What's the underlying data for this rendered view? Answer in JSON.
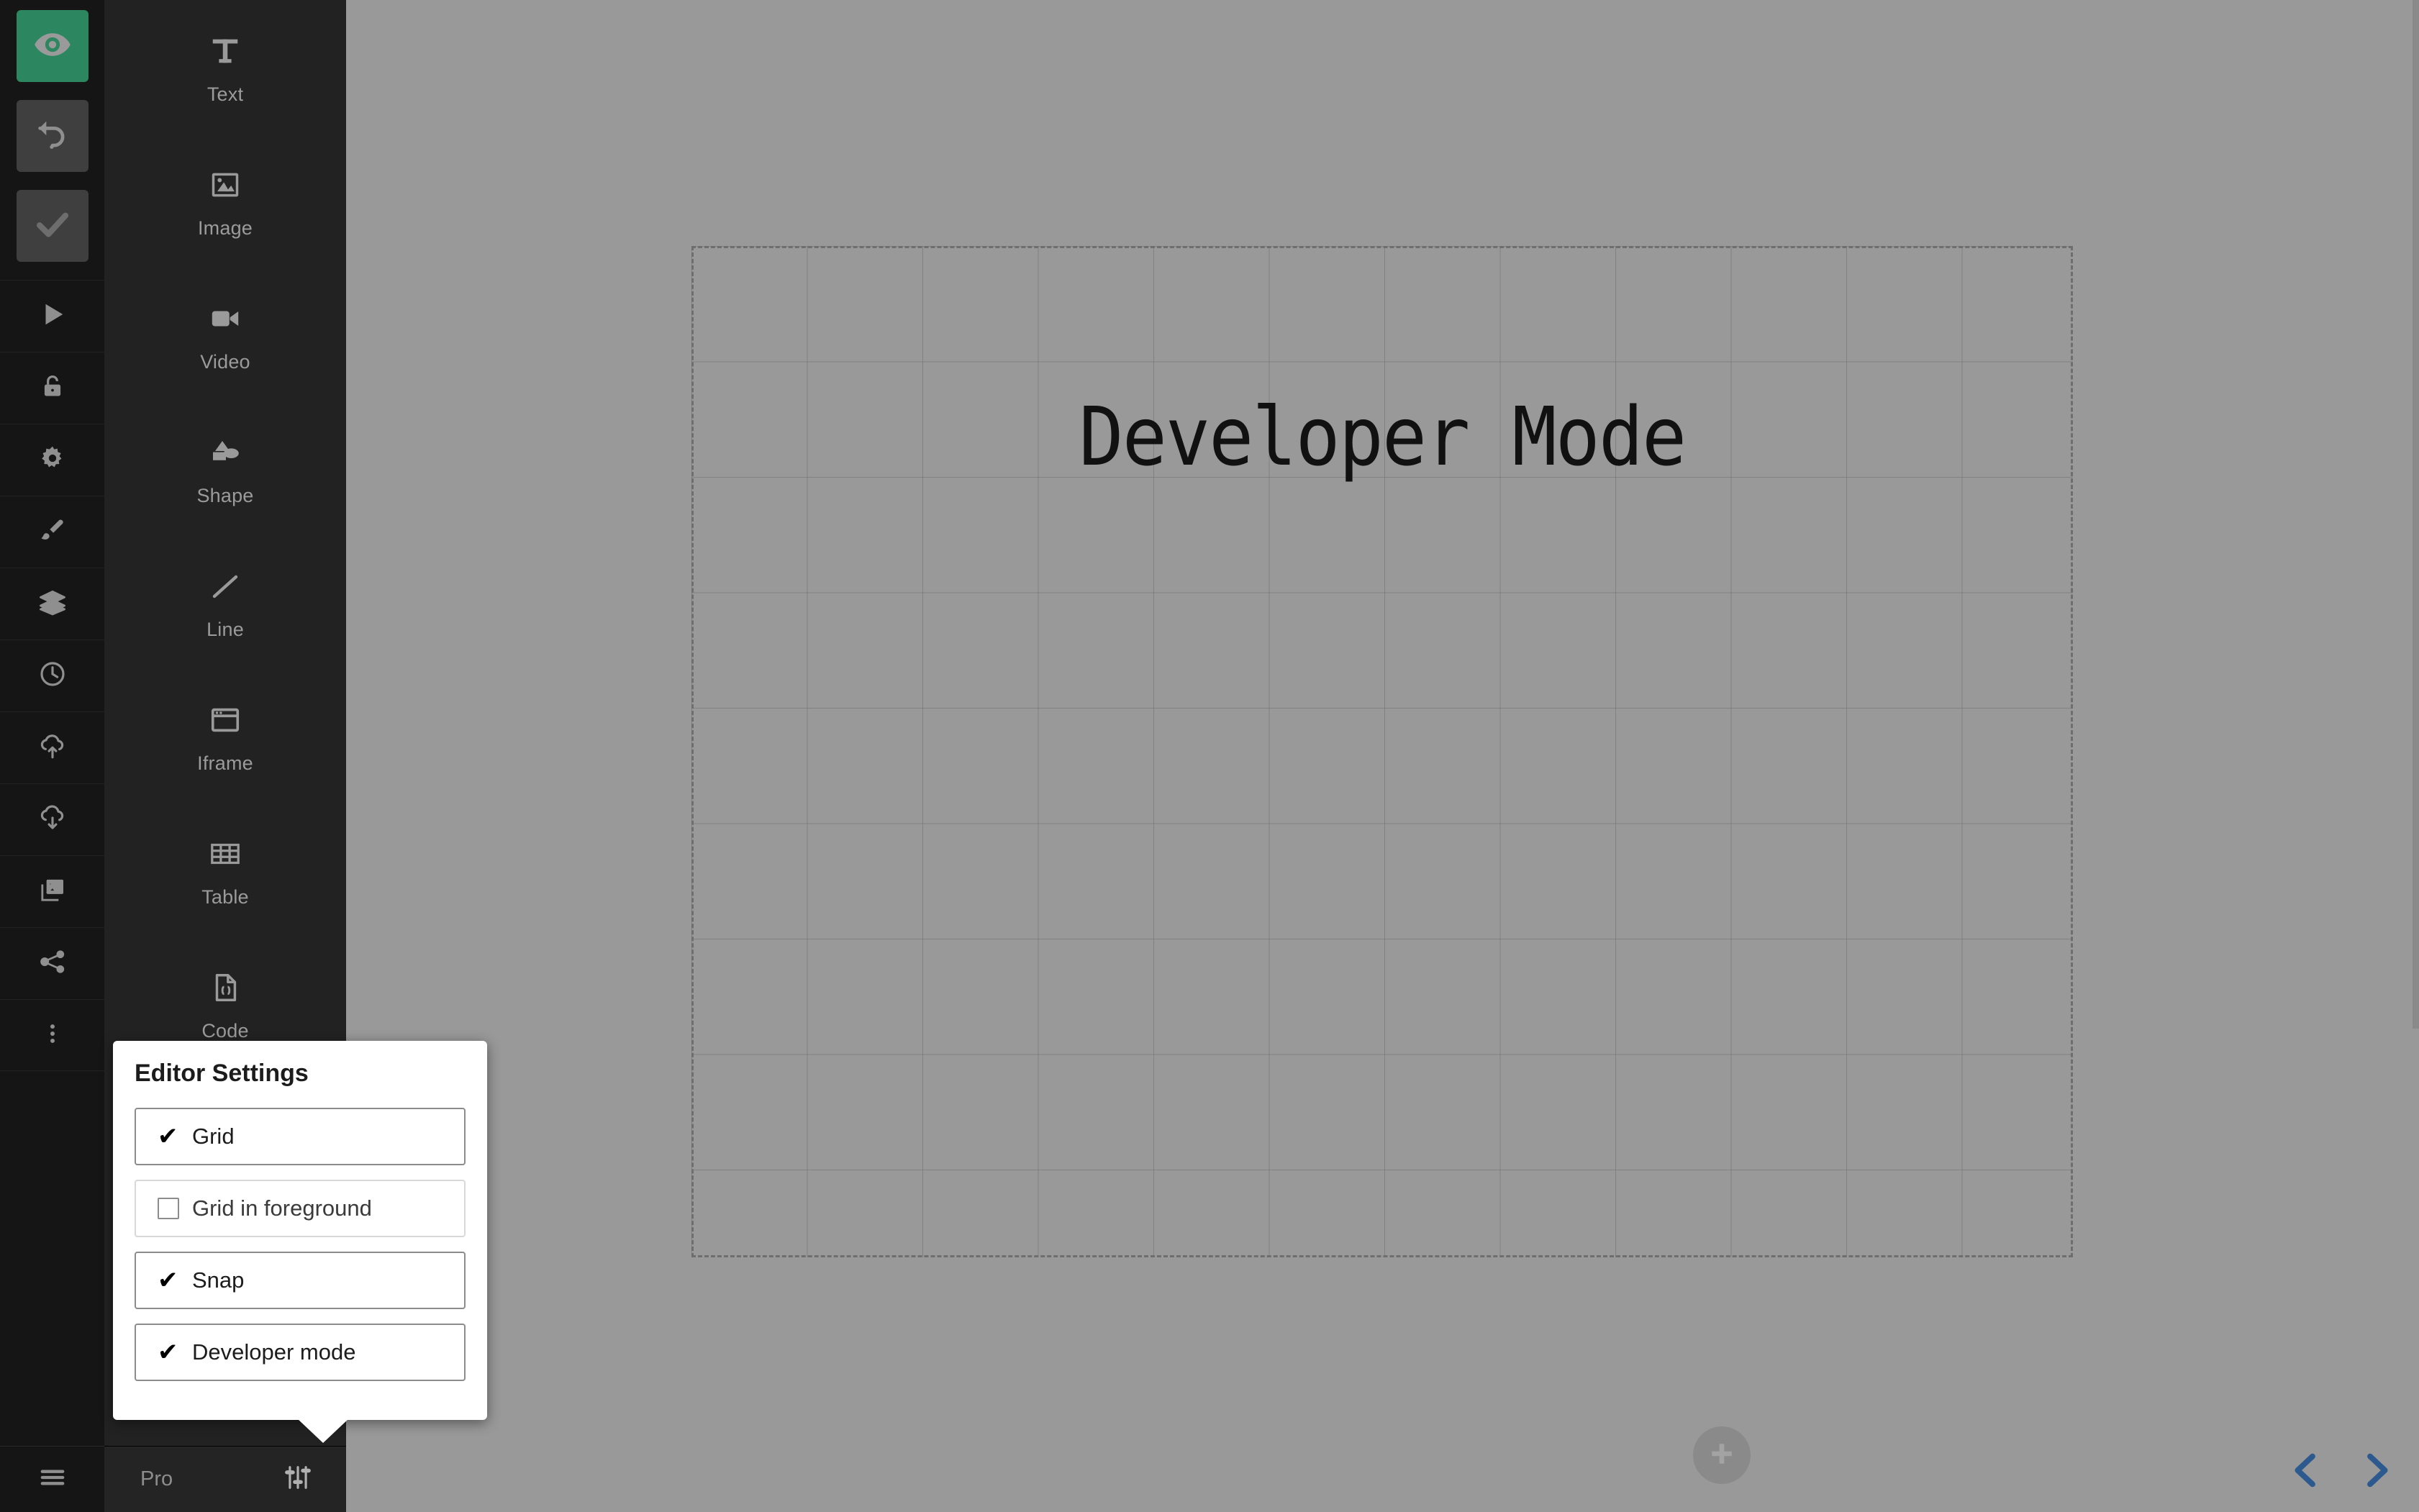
{
  "app": {
    "accent_green": "#2c8761",
    "canvas_bg": "#999999",
    "panel_bg": "#222222",
    "rail_bg": "#151515",
    "nav_arrow_color": "#2c5a8f"
  },
  "left_rail": {
    "top_buttons": [
      {
        "name": "preview-button",
        "icon": "eye-icon",
        "state": "active"
      },
      {
        "name": "undo-button",
        "icon": "undo-icon",
        "state": "normal"
      },
      {
        "name": "publish-button",
        "icon": "checkmark-icon",
        "state": "normal"
      }
    ],
    "items": [
      {
        "name": "sidebar-item-play",
        "icon": "play-icon"
      },
      {
        "name": "sidebar-item-lock",
        "icon": "lock-icon"
      },
      {
        "name": "sidebar-item-settings",
        "icon": "gear-icon"
      },
      {
        "name": "sidebar-item-design",
        "icon": "brush-icon"
      },
      {
        "name": "sidebar-item-layers",
        "icon": "layers-icon"
      },
      {
        "name": "sidebar-item-history",
        "icon": "clock-icon"
      },
      {
        "name": "sidebar-item-upload",
        "icon": "cloud-upload-icon"
      },
      {
        "name": "sidebar-item-download",
        "icon": "cloud-download-icon"
      },
      {
        "name": "sidebar-item-media",
        "icon": "images-icon"
      },
      {
        "name": "sidebar-item-share",
        "icon": "share-icon"
      },
      {
        "name": "sidebar-item-more",
        "icon": "more-vertical-icon"
      }
    ],
    "bottom": {
      "name": "main-menu-button",
      "icon": "hamburger-icon"
    }
  },
  "tool_panel": {
    "tools": [
      {
        "label": "Text",
        "icon": "text-icon"
      },
      {
        "label": "Image",
        "icon": "image-icon"
      },
      {
        "label": "Video",
        "icon": "video-icon"
      },
      {
        "label": "Shape",
        "icon": "shape-icon"
      },
      {
        "label": "Line",
        "icon": "line-icon"
      },
      {
        "label": "Iframe",
        "icon": "iframe-icon"
      },
      {
        "label": "Table",
        "icon": "table-icon"
      },
      {
        "label": "Code",
        "icon": "code-file-icon"
      }
    ],
    "bottom_bar": {
      "plan_label": "Pro",
      "settings_icon": "sliders-icon"
    }
  },
  "canvas": {
    "page_title": "Developer Mode",
    "grid_visible": true,
    "element_toolbar": [
      {
        "name": "element-frame-button",
        "icon": "frame-icon"
      },
      {
        "name": "element-animation-button",
        "icon": "lightning-icon"
      },
      {
        "name": "element-library-button",
        "icon": "book-icon"
      },
      {
        "name": "element-code-button",
        "icon": "code-file-icon"
      },
      {
        "name": "element-delete-button",
        "icon": "trash-icon"
      }
    ],
    "add_section_bottom": {
      "name": "add-section-bottom",
      "icon": "plus-icon"
    },
    "add_section_right": {
      "name": "add-section-right",
      "icon": "plus-icon"
    },
    "collaborators": {
      "name": "collab-button",
      "icon": "users-icon"
    },
    "nav_prev": {
      "name": "prev-page-button",
      "icon": "chevron-left-icon"
    },
    "nav_next": {
      "name": "next-page-button",
      "icon": "chevron-right-icon"
    }
  },
  "editor_settings": {
    "title": "Editor Settings",
    "options": [
      {
        "label": "Grid",
        "checked": true
      },
      {
        "label": "Grid in foreground",
        "checked": false
      },
      {
        "label": "Snap",
        "checked": true
      },
      {
        "label": "Developer mode",
        "checked": true
      }
    ],
    "check_glyph": "✔"
  }
}
